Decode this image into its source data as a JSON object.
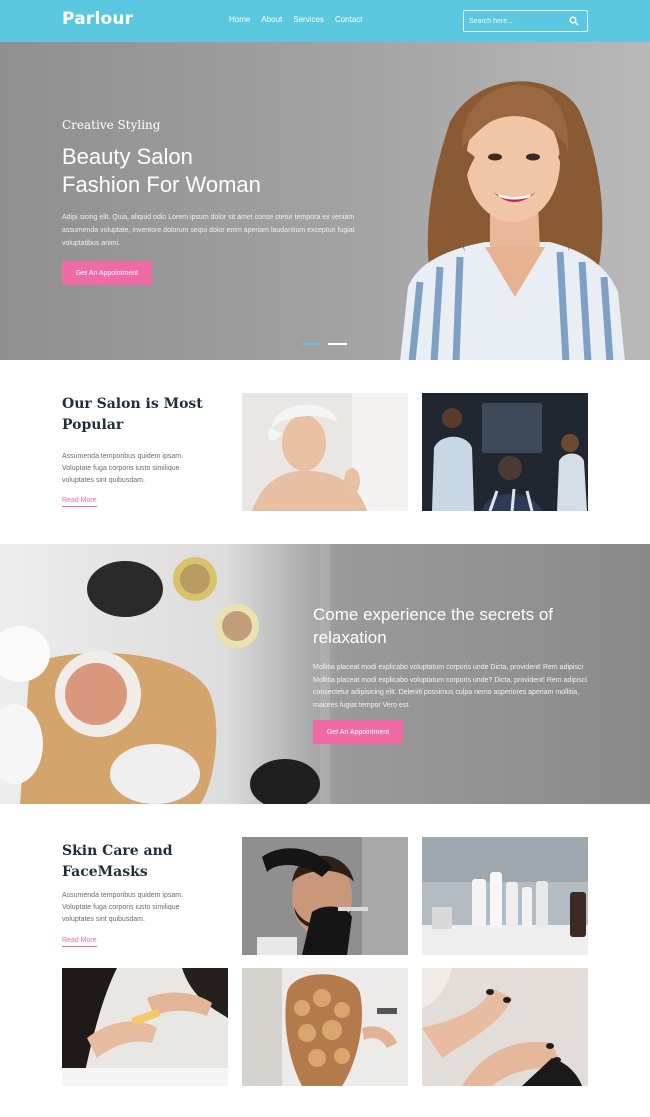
{
  "navbar": {
    "brand": "Parlour",
    "links": [
      "Home",
      "About",
      "Services",
      "Contact"
    ],
    "search_placeholder": "Search here...",
    "search_icon": "search-icon"
  },
  "hero": {
    "eyebrow": "Creative Styling",
    "title_line1": "Beauty Salon",
    "title_line2": "Fashion For Woman",
    "text": "Adipi sicing elit. Quia, aliquid odio Lorem ipsum dolor sit amet conse ctetur tempora ex veniam assumenda voluptate, inventore dolorum sequi dolor enim aperiam laudantium excepturi fugiat voluptatibus animi.",
    "button": "Get An Appointment",
    "slides": 2,
    "active_slide": 1
  },
  "about": {
    "title": "Our Salon is Most Popular",
    "text": "Assumenda temporibus quidem ipsam. Voluptate fuga corporis iusto similique voluptates sint quibusdam.",
    "read_more": "Read More"
  },
  "relax": {
    "title": "Come experience the secrets of relaxation",
    "text": "Mollitia placeat modi explicabo voluptatum corporis unde Dicta, provident! Rem adipisci Mollitia placeat modi explicabo voluptatum corporis unde? Dicta, provident! Rem adipisci consectetur adipisicing elit. Deleniti possimus culpa nemo asperiores aperiam mollitia, maiores fugiat tempor Vero est.",
    "button": "Get An Appointment"
  },
  "skin": {
    "title": "Skin Care and FaceMasks",
    "text": "Assumenda temporibus quidem ipsam. Voluptate fuga corporis iusto similique voluptates sint quibusdam.",
    "read_more": "Read More"
  },
  "colors": {
    "accent_blue": "#5bc8e0",
    "accent_pink": "#f06aa5",
    "heading": "#1f2f3a"
  }
}
